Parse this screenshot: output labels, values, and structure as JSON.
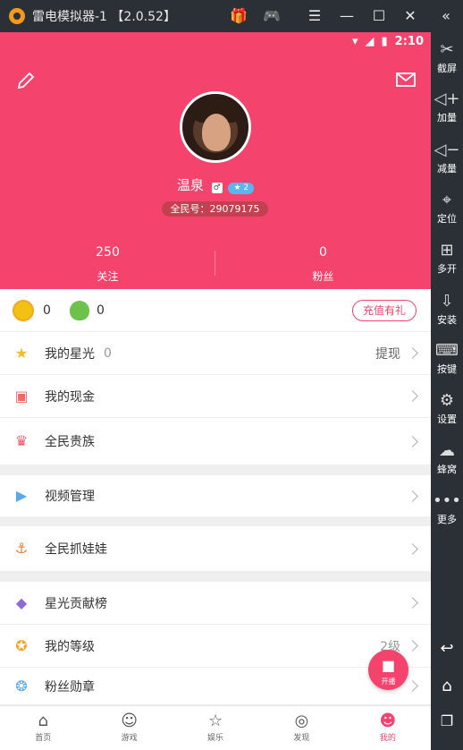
{
  "window": {
    "title": "雷电模拟器-1 【2.0.52】"
  },
  "statusbar": {
    "time": "2:10"
  },
  "profile": {
    "name": "温泉",
    "level_badge": "2",
    "id_text": "全民号：29079175",
    "following_count": "250",
    "following_label": "关注",
    "fans_count": "0",
    "fans_label": "粉丝"
  },
  "wallet": {
    "coin_value": "0",
    "bean_value": "0",
    "recharge_label": "充值有礼"
  },
  "menu": [
    {
      "label": "我的星光",
      "value": "0",
      "action": "提现"
    },
    {
      "label": "我的现金"
    },
    {
      "label": "全民贵族"
    },
    {
      "label": "视频管理"
    },
    {
      "label": "全民抓娃娃"
    },
    {
      "label": "星光贡献榜"
    },
    {
      "label": "我的等级",
      "value": "2级"
    },
    {
      "label": "粉丝勋章"
    }
  ],
  "live_button": {
    "label": "开播"
  },
  "tabs": [
    {
      "label": "首页",
      "icon": "home-icon"
    },
    {
      "label": "游戏",
      "icon": "gamepad-icon"
    },
    {
      "label": "娱乐",
      "icon": "star-icon"
    },
    {
      "label": "发现",
      "icon": "compass-icon"
    },
    {
      "label": "我的",
      "icon": "profile-icon"
    }
  ],
  "sidebar": [
    {
      "label": "截屏",
      "icon": "scissors-icon"
    },
    {
      "label": "加量",
      "icon": "volume-up-icon"
    },
    {
      "label": "减量",
      "icon": "volume-down-icon"
    },
    {
      "label": "定位",
      "icon": "location-icon"
    },
    {
      "label": "多开",
      "icon": "multi-window-icon"
    },
    {
      "label": "安装",
      "icon": "apk-install-icon"
    },
    {
      "label": "按键",
      "icon": "keyboard-icon"
    },
    {
      "label": "设置",
      "icon": "settings-icon"
    },
    {
      "label": "蜂窝",
      "icon": "hive-icon"
    },
    {
      "label": "更多",
      "icon": "more-icon"
    }
  ],
  "colors": {
    "accent": "#f4436d",
    "chrome": "#2b3036"
  }
}
